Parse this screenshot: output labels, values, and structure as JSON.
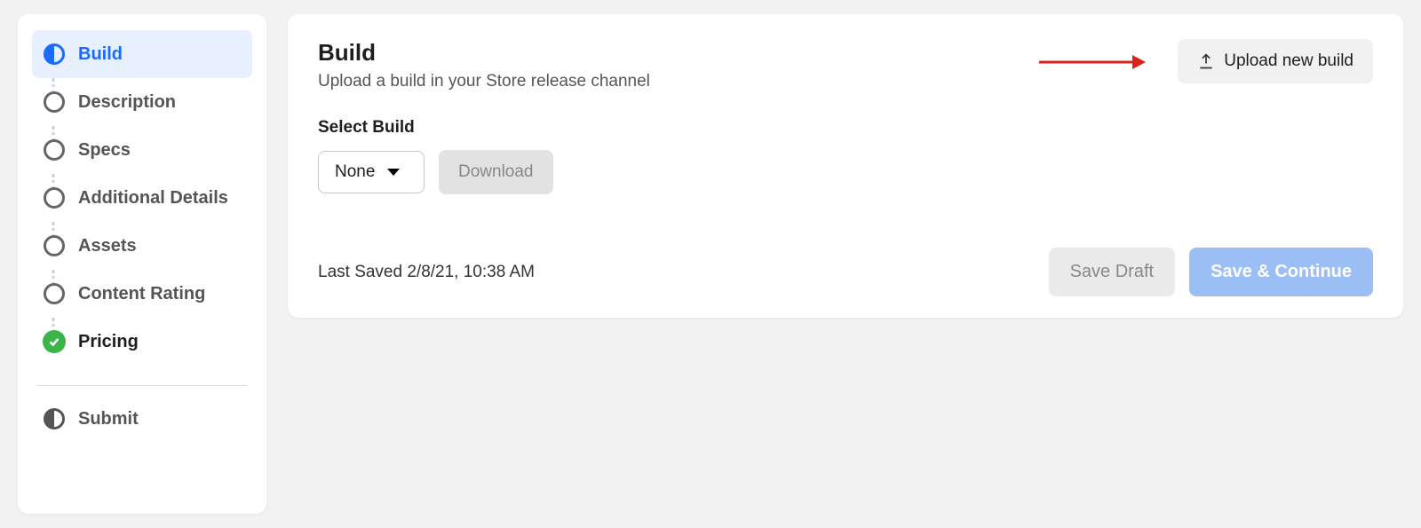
{
  "sidebar": {
    "steps": [
      {
        "label": "Build",
        "state": "active"
      },
      {
        "label": "Description",
        "state": "empty"
      },
      {
        "label": "Specs",
        "state": "empty"
      },
      {
        "label": "Additional Details",
        "state": "empty"
      },
      {
        "label": "Assets",
        "state": "empty"
      },
      {
        "label": "Content Rating",
        "state": "empty"
      },
      {
        "label": "Pricing",
        "state": "done"
      }
    ],
    "submit_label": "Submit"
  },
  "main": {
    "title": "Build",
    "subtitle": "Upload a build in your Store release channel",
    "upload_label": "Upload new build",
    "select_build_label": "Select Build",
    "dropdown_value": "None",
    "download_label": "Download",
    "last_saved": "Last Saved 2/8/21, 10:38 AM",
    "save_draft_label": "Save Draft",
    "save_continue_label": "Save & Continue"
  }
}
